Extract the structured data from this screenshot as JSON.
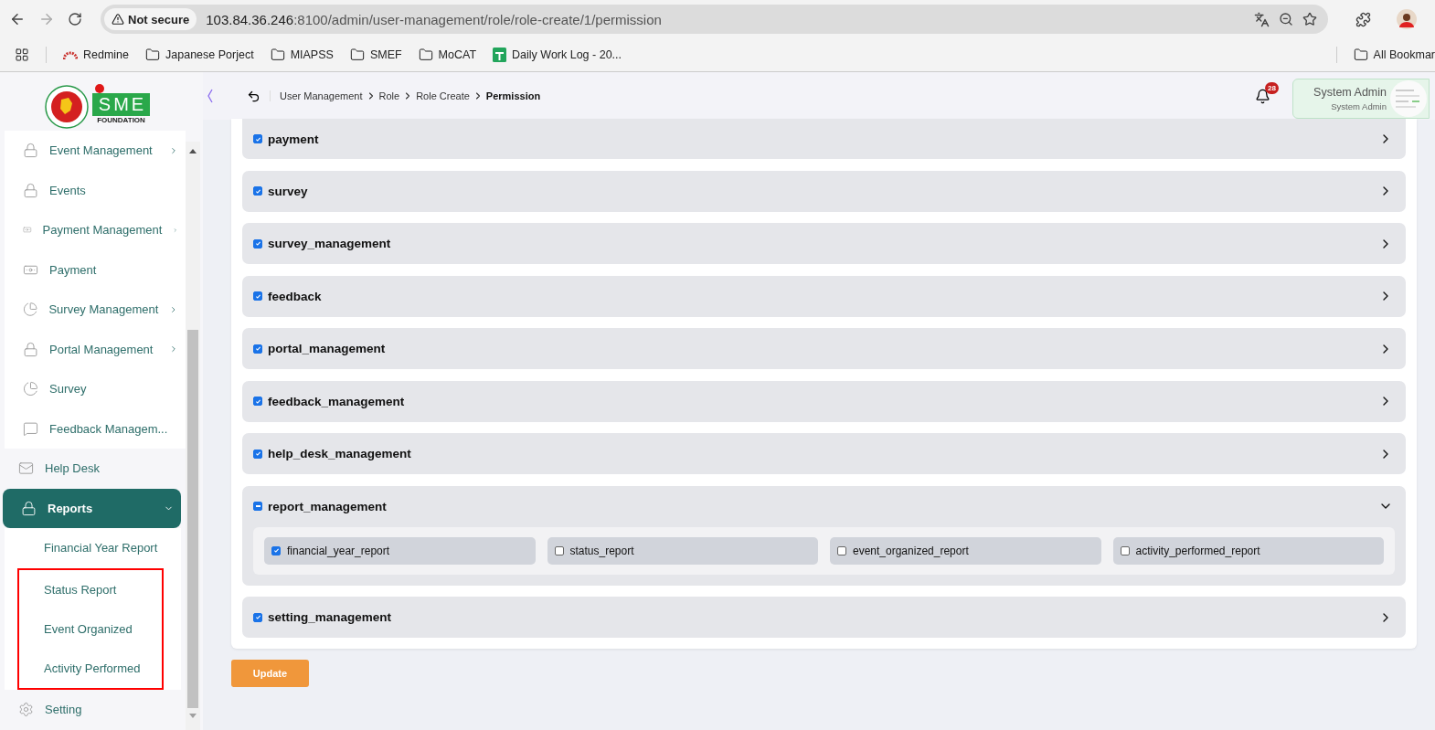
{
  "browser": {
    "security": "Not secure",
    "url_host": "103.84.36.246",
    "url_rest": ":8100/admin/user-management/role/role-create/1/permission",
    "bookmarks": [
      {
        "kind": "apps"
      },
      {
        "kind": "redmine",
        "label": "Redmine"
      },
      {
        "kind": "folder",
        "label": "Japanese Porject"
      },
      {
        "kind": "folder",
        "label": "MIAPSS"
      },
      {
        "kind": "folder",
        "label": "SMEF"
      },
      {
        "kind": "folder",
        "label": "MoCAT"
      },
      {
        "kind": "sheet",
        "label": "Daily Work Log - 20..."
      }
    ],
    "other_bookmarks": "All Bookmar"
  },
  "logo": {
    "word": "SME",
    "subtitle": "FOUNDATION"
  },
  "header": {
    "breadcrumbs": [
      "User Management",
      "Role",
      "Role Create",
      "Permission"
    ],
    "notifications": "28",
    "user": {
      "name": "System Admin",
      "role": "System Admin"
    }
  },
  "sidebar": {
    "items": [
      {
        "label": "Event Management",
        "kind": "lock",
        "submenu": true,
        "selected": false
      },
      {
        "label": "Events",
        "kind": "lock",
        "submenu": false,
        "selected": false
      },
      {
        "label": "Payment Management",
        "kind": "money",
        "submenu": true,
        "selected": false
      },
      {
        "label": "Payment",
        "kind": "money",
        "submenu": false,
        "selected": false
      },
      {
        "label": "Survey Management",
        "kind": "pie",
        "submenu": true,
        "selected": false
      },
      {
        "label": "Portal Management",
        "kind": "lock",
        "submenu": true,
        "selected": false
      },
      {
        "label": "Survey",
        "kind": "pie",
        "submenu": false,
        "selected": false
      },
      {
        "label": "Feedback Managem...",
        "kind": "feedback",
        "submenu": false,
        "selected": false
      }
    ],
    "more_items": [
      {
        "label": "Help Desk",
        "kind": "mail",
        "submenu": false,
        "selected": false
      },
      {
        "label": "Reports",
        "kind": "lock",
        "submenu": true,
        "selected": true,
        "expanded": true,
        "children": [
          {
            "label": "Financial Year Report",
            "highlighted": false
          },
          {
            "label": "Status Report",
            "highlighted": true
          },
          {
            "label": "Event Organized",
            "highlighted": true
          },
          {
            "label": "Activity Performed",
            "highlighted": true
          }
        ]
      },
      {
        "label": "Setting",
        "kind": "gear",
        "submenu": false,
        "selected": false
      }
    ]
  },
  "modules": [
    {
      "name": "payment",
      "checked": true,
      "indeterminate": false,
      "expanded": false
    },
    {
      "name": "survey",
      "checked": true,
      "indeterminate": false,
      "expanded": false
    },
    {
      "name": "survey_management",
      "checked": true,
      "indeterminate": false,
      "expanded": false
    },
    {
      "name": "feedback",
      "checked": true,
      "indeterminate": false,
      "expanded": false
    },
    {
      "name": "portal_management",
      "checked": true,
      "indeterminate": false,
      "expanded": false
    },
    {
      "name": "feedback_management",
      "checked": true,
      "indeterminate": false,
      "expanded": false
    },
    {
      "name": "help_desk_management",
      "checked": true,
      "indeterminate": false,
      "expanded": false
    },
    {
      "name": "report_management",
      "checked": false,
      "indeterminate": true,
      "expanded": true,
      "permissions": [
        {
          "name": "financial_year_report",
          "checked": true
        },
        {
          "name": "status_report",
          "checked": false
        },
        {
          "name": "event_organized_report",
          "checked": false
        },
        {
          "name": "activity_performed_report",
          "checked": false
        }
      ]
    },
    {
      "name": "setting_management",
      "checked": true,
      "indeterminate": false,
      "expanded": false
    }
  ],
  "update_button": "Update"
}
